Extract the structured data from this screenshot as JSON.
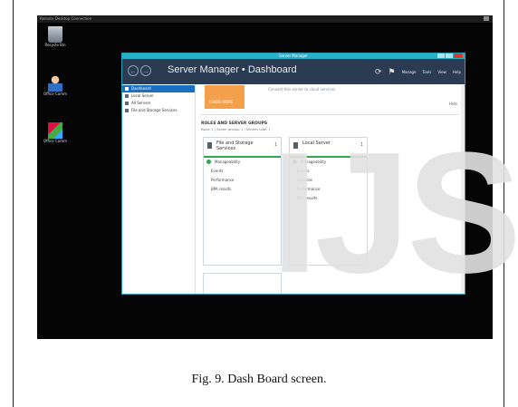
{
  "watermark": "IJS",
  "caption": "Fig. 9.   Dash Board screen.",
  "rdp_bar": {
    "title": "Remote Desktop Connection"
  },
  "desktop_icons": [
    {
      "label": "Recycle Bin",
      "icon": "recycle-bin-icon"
    },
    {
      "label": "Office Comm",
      "icon": "user-icon"
    },
    {
      "label": "Office Comm",
      "icon": "app-icon"
    }
  ],
  "window": {
    "title": "Server Manager",
    "header": {
      "back_glyph": "←",
      "forward_glyph": "→",
      "title": "Server Manager • Dashboard",
      "refresh_glyph": "⟳",
      "flag_glyph": "⚑",
      "menu": [
        "Manage",
        "Tools",
        "View",
        "Help"
      ]
    },
    "sidebar": [
      {
        "label": "Dashboard",
        "active": true
      },
      {
        "label": "Local Server",
        "active": false
      },
      {
        "label": "All Servers",
        "active": false
      },
      {
        "label": "File and Storage Services",
        "active": false
      }
    ],
    "main": {
      "learn_label": "LEARN MORE",
      "connect_text": "Connect this server to cloud services",
      "hide_label": "Hide",
      "groups_title": "ROLES AND SERVER GROUPS",
      "groups_subtitle": "Roles: 1  |  Server groups: 1  |  Servers total: 1",
      "tiles": [
        {
          "title": "File and Storage Services",
          "count": "1",
          "rows": [
            "Manageability",
            "Events",
            "Performance",
            "BPA results"
          ]
        },
        {
          "title": "Local Server",
          "count": "1",
          "rows": [
            "Manageability",
            "Events",
            "Services",
            "Performance",
            "BPA results"
          ]
        }
      ]
    }
  },
  "colors": {
    "nav_bg": "#2b3b52",
    "accent_cyan": "#27b0c8",
    "sidebar_active": "#1a6fc0",
    "learn_orange": "#f4a04a",
    "ok_green": "#2ea84a",
    "close_red": "#d93a2b"
  }
}
